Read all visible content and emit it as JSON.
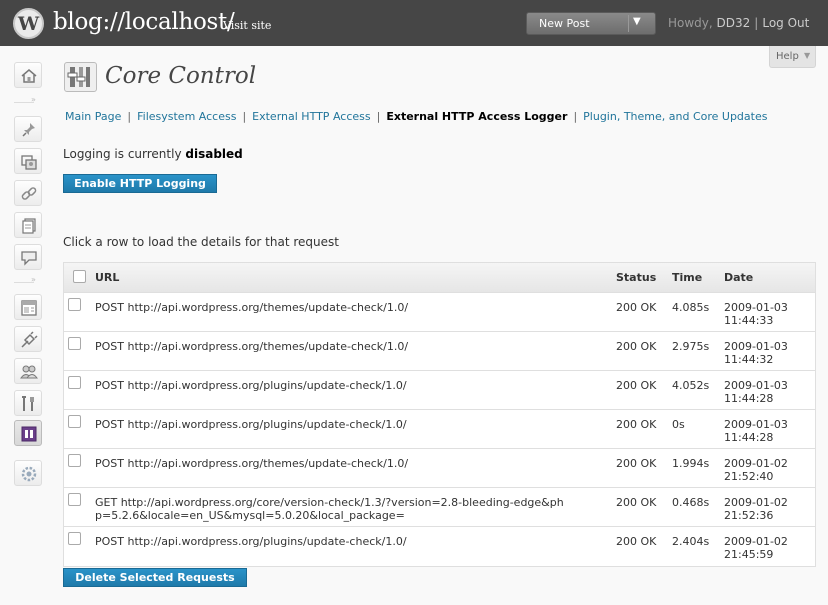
{
  "header": {
    "site_title": "blog://localhost/",
    "visit_site": "Visit site",
    "new_post": "New Post",
    "howdy_prefix": "Howdy,",
    "user": "DD32",
    "separator": "|",
    "logout": "Log Out"
  },
  "help": {
    "label": "Help"
  },
  "page": {
    "title": "Core Control"
  },
  "subnav": {
    "items": [
      {
        "label": "Main Page",
        "current": false
      },
      {
        "label": "Filesystem Access",
        "current": false
      },
      {
        "label": "External HTTP Access",
        "current": false
      },
      {
        "label": "External HTTP Access Logger",
        "current": true
      },
      {
        "label": "Plugin, Theme, and Core Updates",
        "current": false
      }
    ],
    "separator": "|"
  },
  "logging": {
    "prefix": "Logging is currently",
    "state": "disabled",
    "enable_button": "Enable HTTP Logging"
  },
  "table": {
    "intro": "Click a row to load the details for that request",
    "headers": {
      "url": "URL",
      "status": "Status",
      "time": "Time",
      "date": "Date"
    },
    "rows": [
      {
        "url": "POST http://api.wordpress.org/themes/update-check/1.0/",
        "status": "200 OK",
        "time": "4.085s",
        "date": "2009-01-03 11:44:33"
      },
      {
        "url": "POST http://api.wordpress.org/themes/update-check/1.0/",
        "status": "200 OK",
        "time": "2.975s",
        "date": "2009-01-03 11:44:32"
      },
      {
        "url": "POST http://api.wordpress.org/plugins/update-check/1.0/",
        "status": "200 OK",
        "time": "4.052s",
        "date": "2009-01-03 11:44:28"
      },
      {
        "url": "POST http://api.wordpress.org/plugins/update-check/1.0/",
        "status": "200 OK",
        "time": "0s",
        "date": "2009-01-03 11:44:28"
      },
      {
        "url": "POST http://api.wordpress.org/themes/update-check/1.0/",
        "status": "200 OK",
        "time": "1.994s",
        "date": "2009-01-02 21:52:40"
      },
      {
        "url": "GET http://api.wordpress.org/core/version-check/1.3/?version=2.8-bleeding-edge&php=5.2.6&locale=en_US&mysql=5.0.20&local_package=",
        "status": "200 OK",
        "time": "0.468s",
        "date": "2009-01-02 21:52:36"
      },
      {
        "url": "POST http://api.wordpress.org/plugins/update-check/1.0/",
        "status": "200 OK",
        "time": "2.404s",
        "date": "2009-01-02 21:45:59"
      }
    ],
    "delete_button": "Delete Selected Requests"
  },
  "sidebar": {
    "icons": [
      "dashboard-icon",
      "pin-icon",
      "media-icon",
      "links-icon",
      "pages-icon",
      "comments-icon",
      "appearance-icon",
      "plugins-icon",
      "users-icon",
      "tools-icon",
      "core-control-icon",
      "settings-icon"
    ]
  }
}
